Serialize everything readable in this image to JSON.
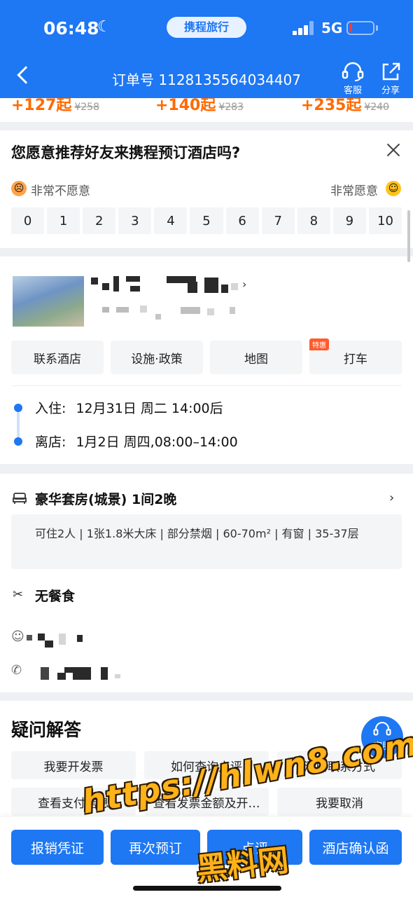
{
  "status_bar": {
    "time": "06:48",
    "moon_glyph": "☾",
    "brand": "携程旅行",
    "network": "5G"
  },
  "nav": {
    "order_label": "订单号 1128135564034407",
    "customer_service": "客服",
    "share": "分享"
  },
  "peek_prices": [
    {
      "price": "+127起",
      "original": "¥258"
    },
    {
      "price": "+140起",
      "original": "¥283"
    },
    {
      "price": "+235起",
      "original": "¥240"
    }
  ],
  "survey": {
    "question": "您愿意推荐好友来携程预订酒店吗?",
    "low_label": "非常不愿意",
    "high_label": "非常愿意",
    "sad_face": "☹",
    "happy_face": "☺",
    "scale": [
      "0",
      "1",
      "2",
      "3",
      "4",
      "5",
      "6",
      "7",
      "8",
      "9",
      "10"
    ]
  },
  "hotel": {
    "chevron": "›",
    "actions": [
      "联系酒店",
      "设施·政策",
      "地图",
      "打车"
    ],
    "promo_badge": "特惠",
    "checkin_label": "入住:",
    "checkin_value": "12月31日 周二 14:00后",
    "checkout_label": "离店:",
    "checkout_value": "1月2日 周四,08:00–14:00"
  },
  "room": {
    "title": "豪华套房(城景)  1间2晚",
    "chevron": "›",
    "details": "可住2人 | 1张1.8米大床 | 部分禁烟 | 60-70m² | 有窗 | 35-37层",
    "meal_icon": "✂",
    "meal": "无餐食",
    "guest_icon": "☺",
    "phone_icon": "✆"
  },
  "faq": {
    "title": "疑问解答",
    "items": [
      "我要开发票",
      "如何查询点评",
      "酒店联系方式",
      "查看支付信息",
      "查看发票金额及开…",
      "我要取消"
    ]
  },
  "fab": {
    "label": "客服"
  },
  "bottom_bar": {
    "reimburse": "报销凭证",
    "middle": "再次预订",
    "review": "点评",
    "confirm": "酒店确认函"
  },
  "watermark": {
    "url": "https://hlwn8.com",
    "name": "黑料网"
  },
  "colors": {
    "brand_blue": "#1e77f3",
    "promo_orange": "#ff5b2c",
    "watermark_orange": "#ffb21a"
  }
}
